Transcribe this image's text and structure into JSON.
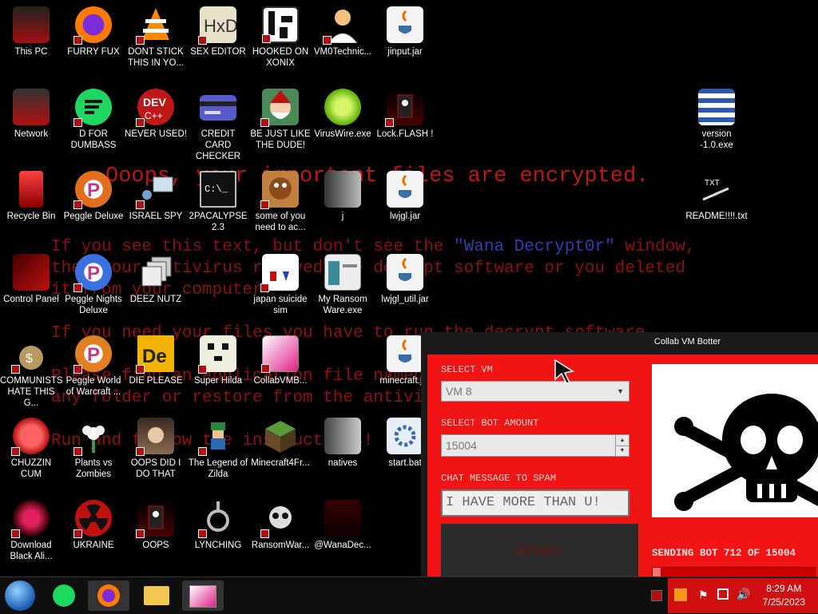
{
  "wallpaper": {
    "title": "Ooops, your important files are encrypted.",
    "lines": [
      "If you see this text, but don't see the ",
      "\"Wana Decrypt0r\"",
      " window,",
      "then your antivirus removed the decrypt software or you deleted",
      "it from your computer.",
      "If you need your files you have to run the decrypt software.",
      "Please find an application file named",
      "any folder or restore from the antivirus quarantine.",
      "Run and follow the instructions!"
    ]
  },
  "icons": [
    {
      "label": "This PC"
    },
    {
      "label": "FURRY FUX"
    },
    {
      "label": "DONT STICK THIS IN YO..."
    },
    {
      "label": "SEX EDITOR"
    },
    {
      "label": "HOOKED ON XONIX"
    },
    {
      "label": "VM0Technic..."
    },
    {
      "label": "jinput.jar"
    },
    {
      "label": "Network"
    },
    {
      "label": "D FOR DUMBASS"
    },
    {
      "label": "NEVER USED!"
    },
    {
      "label": "CREDIT CARD CHECKER"
    },
    {
      "label": "BE JUST LIKE THE DUDE!"
    },
    {
      "label": "VirusWire.exe"
    },
    {
      "label": "Lock.FLASH !"
    },
    {
      "label": "Recycle Bin"
    },
    {
      "label": "Peggle Deluxe"
    },
    {
      "label": "ISRAEL SPY"
    },
    {
      "label": "2PACALYPSE 2.3"
    },
    {
      "label": "some of you need to ac..."
    },
    {
      "label": "j"
    },
    {
      "label": "lwjgl.jar"
    },
    {
      "label": "Control Panel"
    },
    {
      "label": "Peggle Nights Deluxe"
    },
    {
      "label": "DEEZ NUTZ"
    },
    {
      "label": "japan suicide sim"
    },
    {
      "label": "My Ransom Ware.exe"
    },
    {
      "label": "lwjgl_util.jar"
    },
    {
      "label": "COMMUNISTS HATE THIS G..."
    },
    {
      "label": "Peggle World of Warcraft ..."
    },
    {
      "label": "DIE PLEASE"
    },
    {
      "label": "Super Hilda"
    },
    {
      "label": "CollabVMB..."
    },
    {
      "label": "minecraft.jar"
    },
    {
      "label": "CHUZZIN CUM"
    },
    {
      "label": "Plants vs Zombies"
    },
    {
      "label": "OOPS DID I DO THAT"
    },
    {
      "label": "The Legend of Zilda"
    },
    {
      "label": "Minecraft4Fr..."
    },
    {
      "label": "natives"
    },
    {
      "label": "start.bat"
    },
    {
      "label": "Download Black Ali..."
    },
    {
      "label": "UKRAINE"
    },
    {
      "label": "OOPS"
    },
    {
      "label": "LYNCHING"
    },
    {
      "label": "RansomWar..."
    },
    {
      "label": "@WanaDec..."
    },
    {
      "label": "version -1.0.exe"
    },
    {
      "label": "README!!!!.txt"
    }
  ],
  "window": {
    "title": "Collab VM Botter",
    "select_vm_label": "SELECT VM",
    "vm_value": "VM 8",
    "bot_amount_label": "SELECT BOT AMOUNT",
    "bot_amount_value": "15004",
    "chat_label": "CHAT MESSAGE TO SPAM",
    "chat_value": "I HAVE MORE THAN U!",
    "attack_label": "ATTACK",
    "status": "SENDING BOT 712 OF 15004",
    "progress": 0.047
  },
  "taskbar": {
    "time": "8:29 AM",
    "date": "7/25/2023"
  },
  "colors": {
    "accent": "#f01414",
    "text_red": "#b81111",
    "wana_blue": "#2e3fb3"
  }
}
